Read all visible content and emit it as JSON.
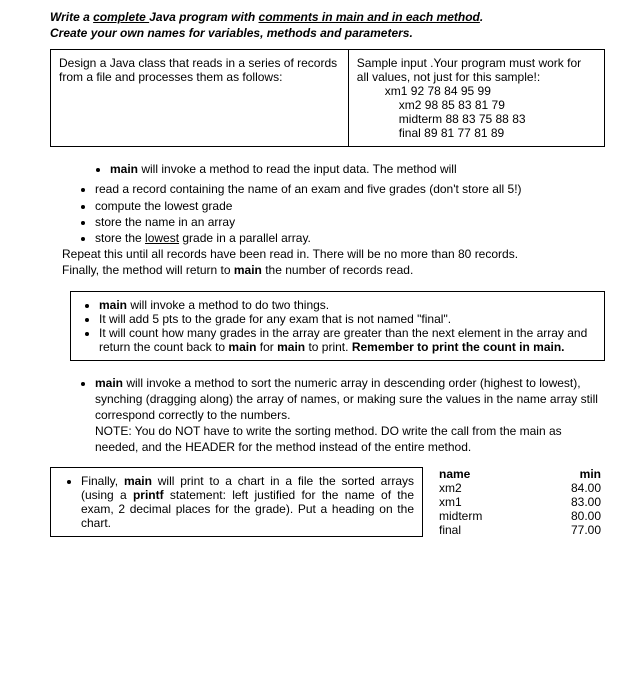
{
  "instructions": {
    "line1_a": "Write a ",
    "line1_b": "complete ",
    "line1_c": "Java program with ",
    "line1_d": "comments in main and in each method",
    "line1_e": ".",
    "line2": "Create your own names for variables, methods and parameters."
  },
  "topbox": {
    "left": "Design a Java class that reads in a series of records from a file and processes them as follows:",
    "right_intro": "Sample input .Your program must work for  all values, not just for this sample!:",
    "samples": {
      "s1": "xm1 92 78 84 95 99",
      "s2": "xm2 98 85 83 81 79",
      "s3": "midterm 88 83 75 88 83",
      "s4": "final 89 81 77 81 89"
    }
  },
  "block1": {
    "l1a": "main",
    "l1b": " will invoke a method to read the input data. The method will",
    "b1": "read a record containing the name of an exam and five grades (don't store all 5!)",
    "b2": "compute the lowest grade",
    "b3": "store the name in an array",
    "b4a": "store the ",
    "b4b": "lowest",
    "b4c": " grade in a parallel array.",
    "r1": "Repeat this until all records have been read in. There will be no more than 80 records.",
    "r2a": "Finally, the method will return to ",
    "r2b": "main",
    "r2c": " the number of records read."
  },
  "box2": {
    "b1a": "main",
    "b1b": " will invoke a method to do two things.",
    "b2": "It will add 5 pts to the grade for any exam that is not named \"final\".",
    "b3a": "It will count how many grades in the array are greater than the next element in the array and return the count back to ",
    "b3b": "main",
    "b3c": " for ",
    "b3d": "main",
    "b3e": " to print. ",
    "b3f": "Remember to print the count in main."
  },
  "sort": {
    "s1a": "main",
    "s1b": " will invoke a method to sort the numeric array in descending order (highest to lowest), synching (dragging along) the array of names, or making sure the values in the name array still correspond correctly to the numbers.",
    "s2": "NOTE: You do NOT have to write the sorting method. DO write the call from the main as needed, and the HEADER for the method instead of the entire method."
  },
  "finalbox": {
    "t1a": "Finally, ",
    "t1b": "main",
    "t1c": " will print to a chart in a file the sorted arrays (using a ",
    "t1d": "printf",
    "t1e": " statement: left justified for the name of the exam, 2 decimal places for the grade). Put a heading on the chart."
  },
  "chart_data": {
    "type": "table",
    "title": "",
    "columns": [
      "name",
      "min"
    ],
    "rows": [
      {
        "name": "xm2",
        "min": "84.00"
      },
      {
        "name": "xm1",
        "min": "83.00"
      },
      {
        "name": "midterm",
        "min": "80.00"
      },
      {
        "name": "final",
        "min": "77.00"
      }
    ]
  }
}
